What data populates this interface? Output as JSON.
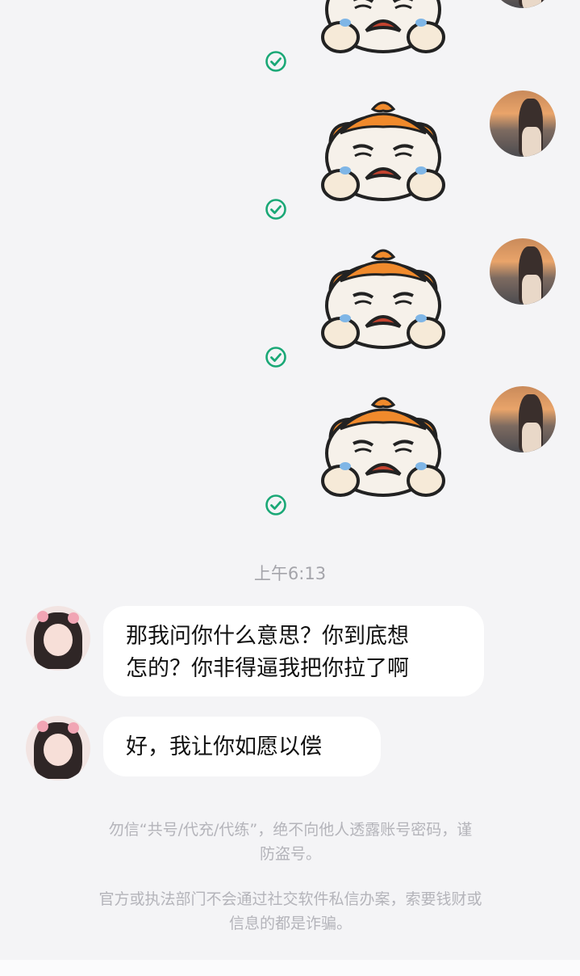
{
  "messages": {
    "sent_stickers": [
      {
        "sticker": "crying-cartoon-sticker",
        "status": "read-check-icon"
      },
      {
        "sticker": "crying-cartoon-sticker",
        "status": "read-check-icon"
      },
      {
        "sticker": "crying-cartoon-sticker",
        "status": "read-check-icon"
      },
      {
        "sticker": "crying-cartoon-sticker",
        "status": "read-check-icon"
      }
    ],
    "timestamp": "上午6:13",
    "received": [
      {
        "line1": "那我问你什么意思？你到底想",
        "line2": "怎的？你非得逼我把你拉了啊"
      },
      {
        "line1": "好，我让你如愿以偿"
      }
    ]
  },
  "notices": {
    "notice1_line1": "勿信“共号/代充/代练”，绝不向他人透露账号密码，谨",
    "notice1_line2": "防盗号。",
    "notice2_line1": "官方或执法部门不会通过社交软件私信办案，索要钱财或",
    "notice2_line2": "信息的都是诈骗。"
  },
  "colors": {
    "background": "#f4f4f6",
    "check": "#1aa876",
    "sticker_orange": "#f08a2c"
  }
}
